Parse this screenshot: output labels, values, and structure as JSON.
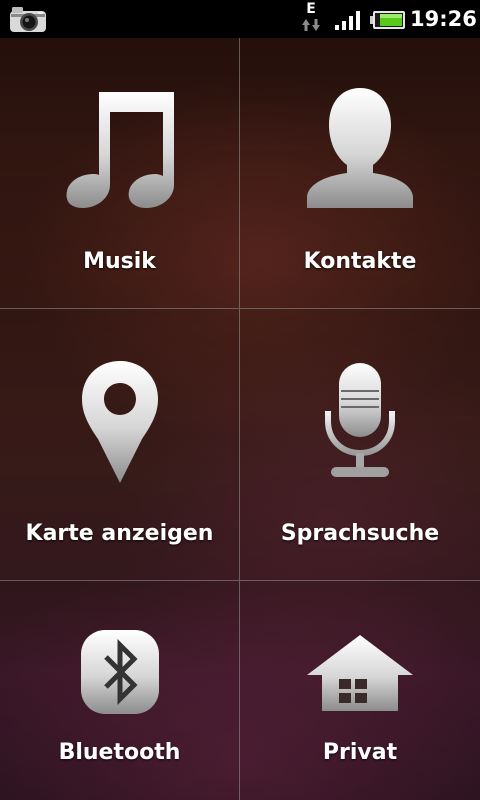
{
  "status_bar": {
    "network_type": "E",
    "time": "19:26",
    "icons": [
      "camera-icon",
      "network-activity-icon",
      "signal-strength-icon",
      "battery-icon"
    ],
    "colors": {
      "background": "#000000",
      "battery_fill": "#58c81a"
    }
  },
  "tiles": [
    {
      "label": "Musik",
      "icon": "music-note-icon"
    },
    {
      "label": "Kontakte",
      "icon": "contact-person-icon"
    },
    {
      "label": "Karte anzeigen",
      "icon": "map-pin-icon"
    },
    {
      "label": "Sprachsuche",
      "icon": "microphone-icon"
    },
    {
      "label": "Bluetooth",
      "icon": "bluetooth-icon"
    },
    {
      "label": "Privat",
      "icon": "home-icon"
    }
  ],
  "colors": {
    "icon_gradient_top": "#ffffff",
    "icon_gradient_bottom": "#8a8a8a",
    "label": "#ffffff",
    "divider": "#969696"
  }
}
